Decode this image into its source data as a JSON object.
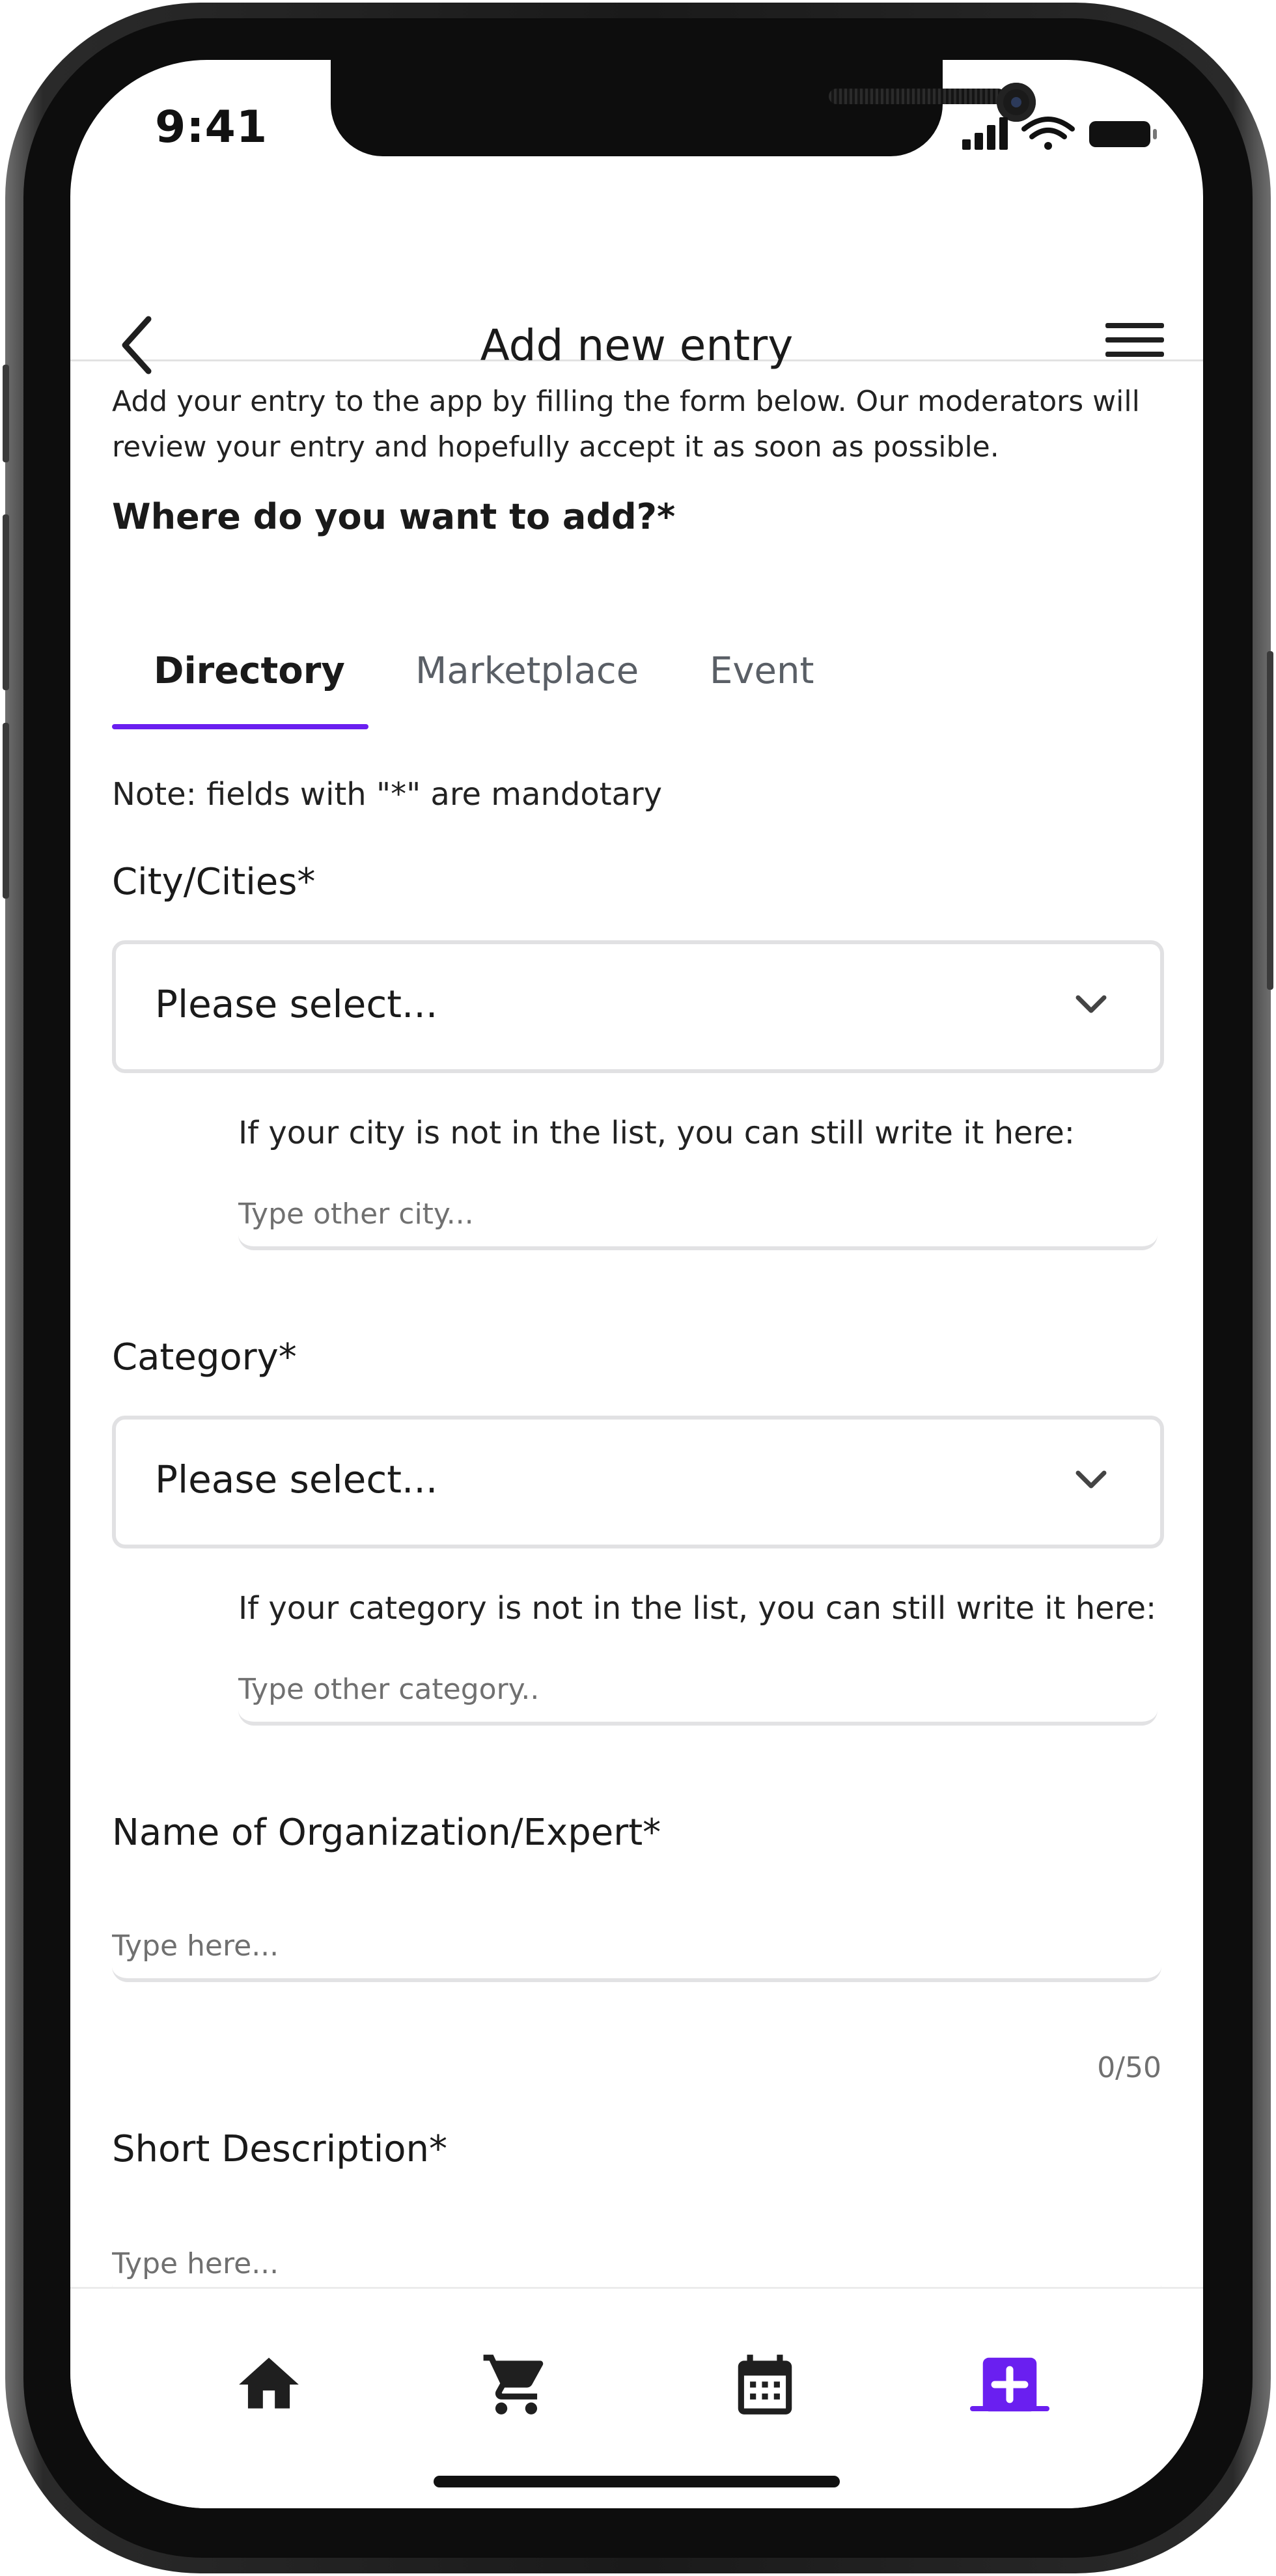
{
  "status_bar": {
    "time": "9:41"
  },
  "header": {
    "title": "Add new entry"
  },
  "intro_text": "Add your entry to the app by filling the form below. Our moderators will review your entry and hopefully accept it as soon as possible.",
  "question": "Where do you want to add?*",
  "tabs": [
    {
      "label": "Directory",
      "active": true
    },
    {
      "label": "Marketplace",
      "active": false
    },
    {
      "label": "Event",
      "active": false
    }
  ],
  "note": "Note: fields with \"*\" are mandotary",
  "city": {
    "label": "City/Cities*",
    "select_value": "Please select...",
    "helper": "If your city is not in the list, you can still write it here:",
    "other_placeholder": "Type other city..."
  },
  "category": {
    "label": "Category*",
    "select_value": "Please select...",
    "helper": "If your category is not in the list, you can still write it here:",
    "other_placeholder": "Type other category.."
  },
  "name": {
    "label": "Name of Organization/Expert*",
    "placeholder": "Type here...",
    "counter": "0/50"
  },
  "description": {
    "label": "Short Description*",
    "placeholder": "Type here..."
  },
  "bottom_nav": [
    {
      "icon": "home-icon",
      "active": false
    },
    {
      "icon": "cart-icon",
      "active": false
    },
    {
      "icon": "calendar-icon",
      "active": false
    },
    {
      "icon": "add-box-icon",
      "active": true
    }
  ],
  "colors": {
    "accent": "#6a1ff0",
    "text": "#1a1a1a",
    "muted": "#707070",
    "border": "#e1e1e3"
  }
}
